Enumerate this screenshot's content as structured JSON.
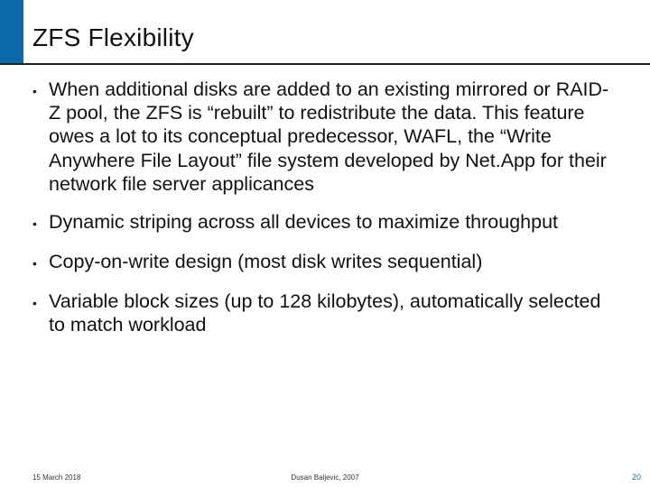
{
  "slide": {
    "title": "ZFS Flexibility",
    "bullets": [
      "When additional disks are added to an existing mirrored or RAID-Z pool, the ZFS is “rebuilt” to redistribute the data. This feature owes a lot to its conceptual predecessor, WAFL, the “Write Anywhere File Layout” file system developed by Net.App for their network file server applicances",
      "Dynamic striping across all devices to maximize throughput",
      "Copy-on-write design (most disk writes sequential)",
      "Variable block sizes (up to 128 kilobytes), automatically selected to match workload"
    ]
  },
  "footer": {
    "date": "15 March 2018",
    "author": "Dusan Baljevic, 2007",
    "page": "20"
  },
  "colors": {
    "accent": "#0d6aa8"
  }
}
